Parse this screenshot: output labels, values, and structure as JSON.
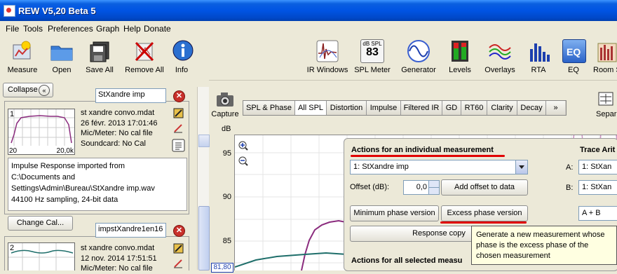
{
  "window": {
    "title": "REW V5,20 Beta 5"
  },
  "menu": [
    "File",
    "Tools",
    "Preferences",
    "Graph",
    "Help",
    "Donate"
  ],
  "toolbar_left": [
    {
      "label": "Measure",
      "icon": "measure-icon"
    },
    {
      "label": "Open",
      "icon": "folder-icon"
    },
    {
      "label": "Save All",
      "icon": "save-all-icon"
    },
    {
      "label": "Remove All",
      "icon": "remove-all-icon"
    },
    {
      "label": "Info",
      "icon": "info-icon"
    }
  ],
  "toolbar_right": [
    {
      "label": "IR Windows",
      "icon": "ir-windows-icon"
    },
    {
      "label": "SPL Meter",
      "icon": "spl-meter-icon",
      "badge_top": "dB SPL",
      "badge_value": "83"
    },
    {
      "label": "Generator",
      "icon": "generator-icon"
    },
    {
      "label": "Levels",
      "icon": "levels-icon"
    },
    {
      "label": "Overlays",
      "icon": "overlays-icon"
    },
    {
      "label": "RTA",
      "icon": "rta-icon"
    },
    {
      "label": "EQ",
      "icon": "eq-icon"
    },
    {
      "label": "Room Si",
      "icon": "room-sim-icon"
    }
  ],
  "left": {
    "collapse_label": "Collapse",
    "change_cal_label": "Change Cal...",
    "measurements": [
      {
        "number": "1",
        "name": "StXandre imp",
        "thumb_x_start": "20",
        "thumb_x_end": "20,0k",
        "info": [
          "st xandre convo.mdat",
          "26 févr. 2013 17:01:46",
          "Mic/Meter: No cal file",
          "Soundcard: No Cal"
        ],
        "description": [
          "Impulse Response imported from",
          "C:\\Documents and",
          "Settings\\Admin\\Bureau\\StXandre imp.wav",
          "44100 Hz sampling, 24-bit data"
        ]
      },
      {
        "number": "2",
        "name": "impstXandre1en16",
        "info": [
          "st xandre convo.mdat",
          "12 nov. 2014 17:51:51",
          "Mic/Meter: No cal file"
        ]
      }
    ]
  },
  "capture_label": "Capture",
  "tabs": [
    "SPL & Phase",
    "All SPL",
    "Distortion",
    "Impulse",
    "Filtered IR",
    "GD",
    "RT60",
    "Clarity",
    "Decay",
    "»"
  ],
  "selected_tab": "All SPL",
  "separate_label": "Separ",
  "plot": {
    "y_unit": "dB",
    "y_ticks": [
      "95",
      "90",
      "85"
    ],
    "cursor_readout": "81,80"
  },
  "actions": {
    "individual_title": "Actions for an individual measurement",
    "measurement_select": "1: StXandre imp",
    "offset_label": "Offset (dB):",
    "offset_value": "0,0",
    "add_offset_label": "Add offset to data",
    "min_phase_label": "Minimum phase version",
    "excess_phase_label": "Excess phase version",
    "response_copy_label": "Response copy",
    "all_selected_title": "Actions for all selected measu",
    "trace_title": "Trace Arit",
    "a_label": "A:",
    "a_value": "1: StXan",
    "b_label": "B:",
    "b_value": "1: StXan",
    "op_value": "A + B",
    "tooltip": [
      "Generate a new measurement whose",
      "phase is the excess phase of the",
      "chosen measurement"
    ]
  },
  "colors": {
    "title_bar": "#0054E3",
    "trace_1": "#8B2C7E",
    "trace_2": "#1E6E6A",
    "trace_pink": "#C98FBF",
    "highlight_red": "#E00000",
    "tooltip_bg": "#FFFFE1"
  }
}
